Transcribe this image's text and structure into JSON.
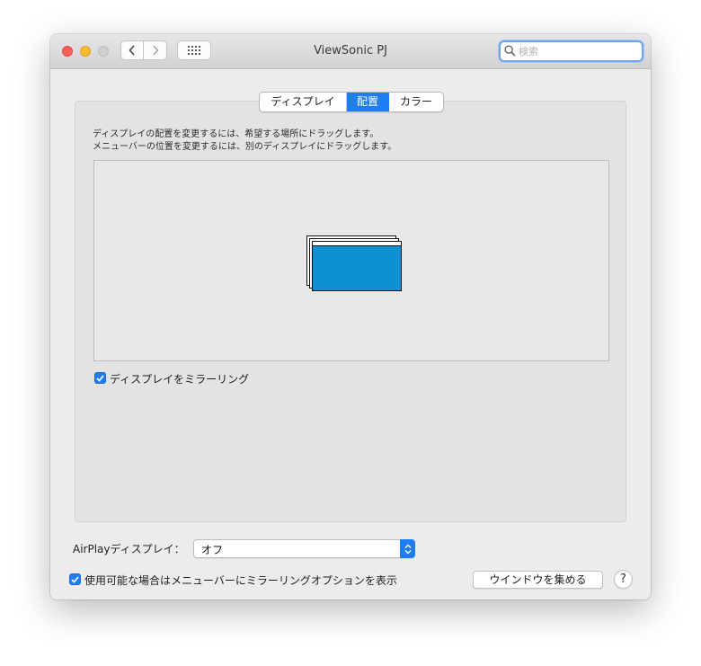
{
  "window": {
    "title": "ViewSonic PJ"
  },
  "search": {
    "placeholder": "検索"
  },
  "tabs": [
    {
      "label": "ディスプレイ",
      "active": false
    },
    {
      "label": "配置",
      "active": true
    },
    {
      "label": "カラー",
      "active": false
    }
  ],
  "arrangement": {
    "description_line1": "ディスプレイの配置を変更するには、希望する場所にドラッグします。",
    "description_line2": "メニューバーの位置を変更するには、別のディスプレイにドラッグします。",
    "mirror_checkbox": {
      "label": "ディスプレイをミラーリング",
      "checked": true
    }
  },
  "airplay": {
    "label": "AirPlayディスプレイ：",
    "value": "オフ"
  },
  "footer": {
    "menu_option_checkbox": {
      "label": "使用可能な場合はメニューバーにミラーリングオプションを表示",
      "checked": true
    },
    "gather_button": "ウインドウを集める",
    "help_label": "?"
  },
  "colors": {
    "accent": "#1f7df0",
    "display_fill": "#0f90d2"
  },
  "icons": [
    "back-chevron-icon",
    "forward-chevron-icon",
    "grid-icon",
    "search-icon",
    "checkmark-icon",
    "updown-arrows-icon"
  ]
}
